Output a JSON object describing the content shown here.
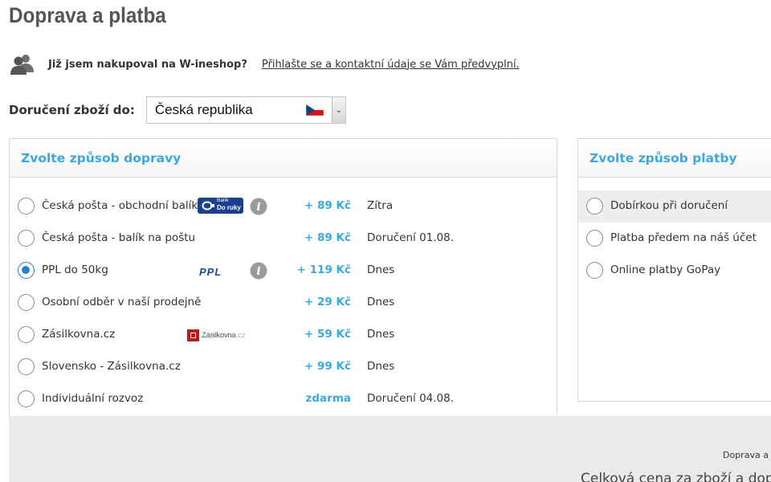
{
  "page": {
    "title": "Doprava a platba"
  },
  "login": {
    "question": "Již jsem nakupoval na W-ineshop?",
    "link": "Přihlašte se a kontaktní údaje se Vám předvyplní.",
    "icon": "users-icon"
  },
  "delivery_country": {
    "label": "Doručení zboží do:",
    "value": "Česká republika",
    "flag": "czech-flag-icon"
  },
  "shipping": {
    "title": "Zvolte způsob dopravy",
    "options": [
      {
        "label": "Česká pošta - obchodní balík",
        "price": "+ 89 Kč",
        "date": "Zítra",
        "logo": "balik-do-ruky",
        "logo_line1": "Balík",
        "logo_line2": "Do ruky",
        "info": true,
        "selected": false
      },
      {
        "label": "Česká pošta - balík na poštu",
        "price": "+ 89 Kč",
        "date": "Doručení 01.08.",
        "selected": false
      },
      {
        "label": "PPL do 50kg",
        "price": "+ 119 Kč",
        "date": "Dnes",
        "logo": "ppl",
        "logo_text": "PPL",
        "info": true,
        "selected": true
      },
      {
        "label": "Osobní odběr v naší prodejně",
        "price": "+ 29 Kč",
        "date": "Dnes",
        "selected": false
      },
      {
        "label": "Zásilkovna.cz",
        "price": "+ 59 Kč",
        "date": "Dnes",
        "logo": "zasilkovna",
        "logo_text": "Zásilkovna",
        "logo_suffix": ".cz",
        "selected": false
      },
      {
        "label": "Slovensko - Zásilkovna.cz",
        "price": "+ 99 Kč",
        "date": "Dnes",
        "selected": false
      },
      {
        "label": "Individuální rozvoz",
        "price": "zdarma",
        "date": "Doručení 04.08.",
        "selected": false
      }
    ]
  },
  "payment": {
    "title": "Zvolte způsob platby",
    "options": [
      {
        "label": "Dobírkou při doručení",
        "selected": false
      },
      {
        "label": "Platba předem na náš účet",
        "selected": false
      },
      {
        "label": "Online platby GoPay",
        "selected": false
      }
    ]
  },
  "summary": {
    "line1": "Doprava a p",
    "line2": "Celková cena za zboží a dopra"
  },
  "colors": {
    "accent": "#3ba9dd",
    "radio_selected": "#2a7fcf",
    "summary_bg": "#eaeaea"
  }
}
